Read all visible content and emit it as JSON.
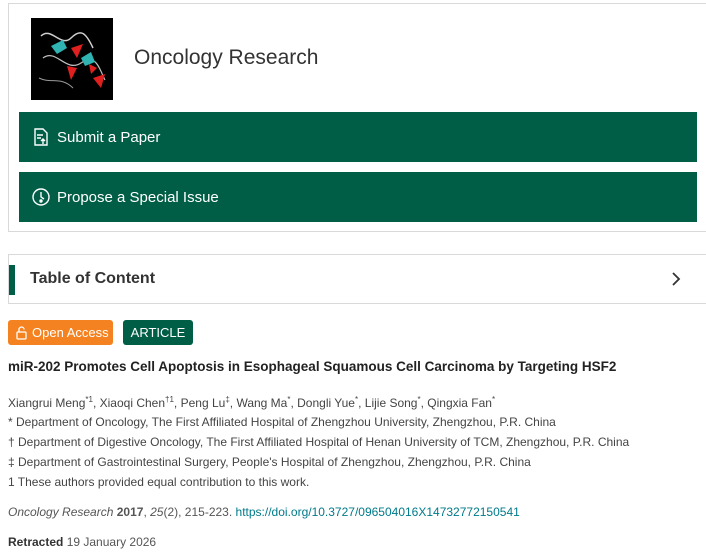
{
  "journal": {
    "title": "Oncology Research",
    "submit_label": "Submit a Paper",
    "propose_label": "Propose a Special Issue"
  },
  "toc": {
    "title": "Table of Content"
  },
  "badges": {
    "open_access": "Open Access",
    "type": "ARTICLE"
  },
  "article": {
    "title": "miR-202 Promotes Cell Apoptosis in Esophageal Squamous Cell Carcinoma by Targeting HSF2",
    "authors": [
      {
        "name": "Xiangrui Meng",
        "sup": "*1"
      },
      {
        "name": "Xiaoqi Chen",
        "sup": "†1"
      },
      {
        "name": "Peng Lu",
        "sup": "‡"
      },
      {
        "name": "Wang Ma",
        "sup": "*"
      },
      {
        "name": "Dongli Yue",
        "sup": "*"
      },
      {
        "name": "Lijie Song",
        "sup": "*"
      },
      {
        "name": "Qingxia Fan",
        "sup": "*"
      }
    ],
    "affiliations": [
      "* Department of Oncology, The First Affiliated Hospital of Zhengzhou University, Zhengzhou, P.R. China",
      "† Department of Digestive Oncology, The First Affiliated Hospital of Henan University of TCM, Zhengzhou, P.R. China",
      "‡ Department of Gastrointestinal Surgery, People's Hospital of Zhengzhou, Zhengzhou, P.R. China",
      "1 These authors provided equal contribution to this work."
    ],
    "citation": {
      "journal": "Oncology Research",
      "year": "2017",
      "volume": "25",
      "issue": "(2), 215-223.",
      "doi": "https://doi.org/10.3727/096504016X14732772150541"
    },
    "retracted": {
      "label": "Retracted",
      "date": "19 January 2026"
    }
  },
  "colors": {
    "brand_green": "#005e46",
    "open_access_orange": "#f58220",
    "link_teal": "#007a8a"
  }
}
